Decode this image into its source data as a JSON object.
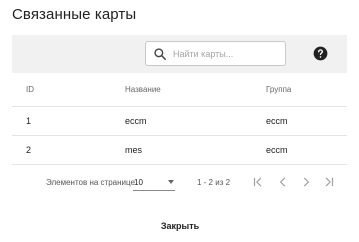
{
  "dialog": {
    "title": "Связанные карты",
    "close_label": "Закрыть"
  },
  "search": {
    "placeholder": "Найти карты...",
    "value": ""
  },
  "table": {
    "headers": {
      "id": "ID",
      "name": "Название",
      "group": "Группа"
    },
    "rows": [
      {
        "id": "1",
        "name": "eccm",
        "group": "eccm"
      },
      {
        "id": "2",
        "name": "mes",
        "group": "eccm"
      }
    ]
  },
  "paginator": {
    "items_per_page_label": "Элементов на странице",
    "page_size": "10",
    "range_label": "1 - 2 из 2"
  },
  "icons": {
    "search": "search-icon",
    "help": "help-icon",
    "first": "first-page-icon",
    "prev": "chevron-left-icon",
    "next": "chevron-right-icon",
    "last": "last-page-icon"
  }
}
